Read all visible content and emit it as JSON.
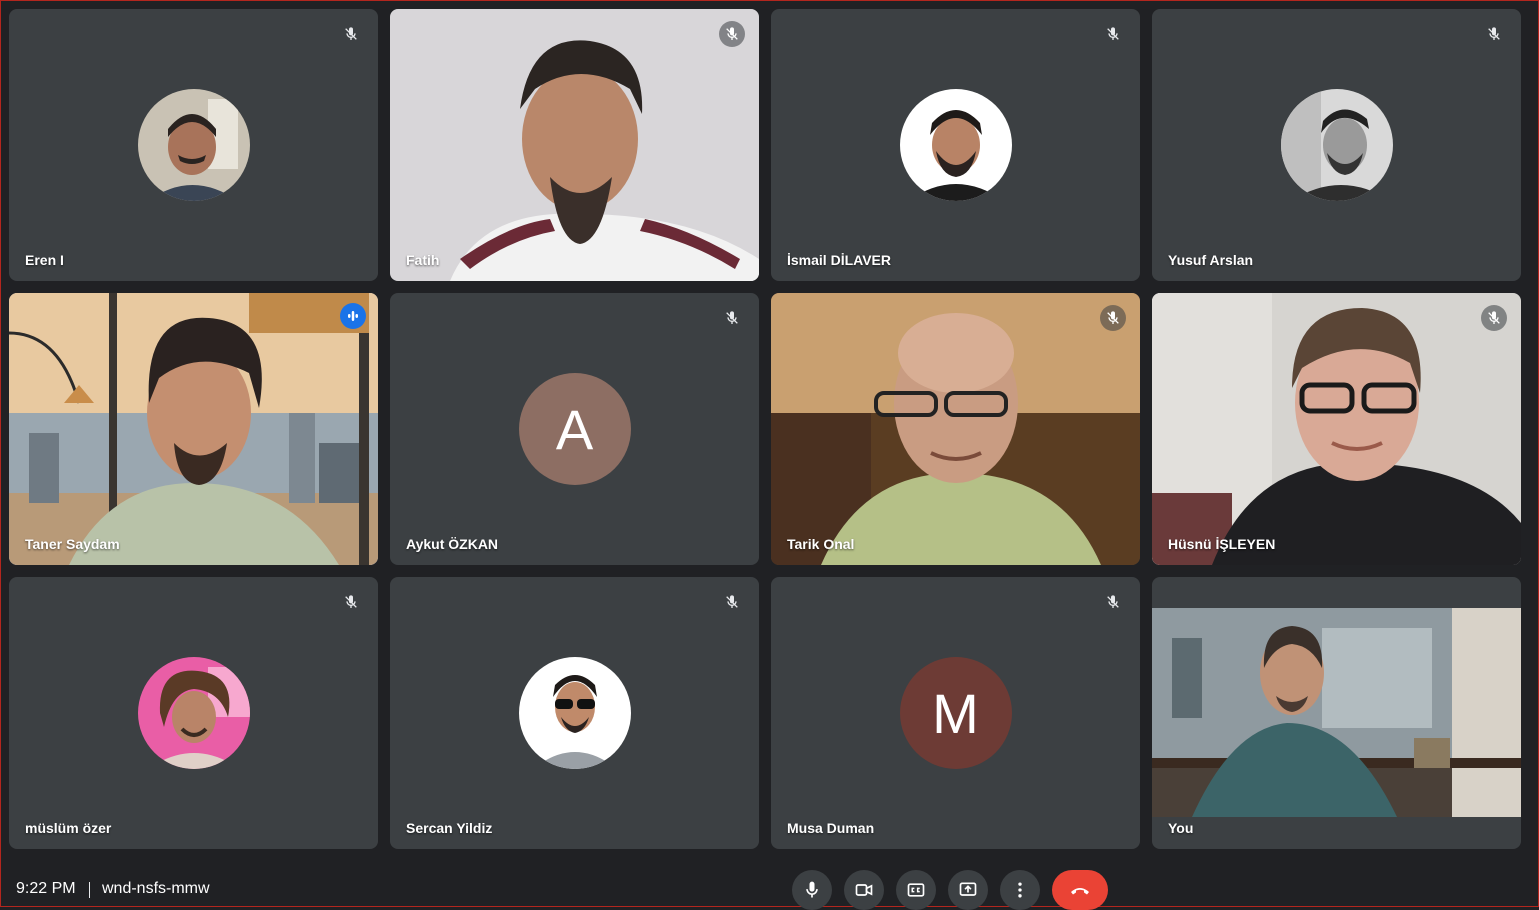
{
  "meeting": {
    "time": "9:22 PM",
    "code": "wnd-nsfs-mmw"
  },
  "participants": [
    {
      "name": "Eren I",
      "mode": "avatar-photo",
      "muted": true
    },
    {
      "name": "Fatih",
      "mode": "video",
      "muted": true
    },
    {
      "name": "İsmail DİLAVER",
      "mode": "avatar-photo",
      "muted": true
    },
    {
      "name": "Yusuf Arslan",
      "mode": "avatar-photo",
      "muted": true
    },
    {
      "name": "Taner Saydam",
      "mode": "video",
      "muted": false,
      "speaking": true
    },
    {
      "name": "Aykut ÖZKAN",
      "mode": "letter",
      "letter": "A",
      "color": "#8d6e63",
      "muted": true
    },
    {
      "name": "Tarik Onal",
      "mode": "video",
      "muted": true
    },
    {
      "name": "Hüsnü İŞLEYEN",
      "mode": "video",
      "muted": true
    },
    {
      "name": "müslüm özer",
      "mode": "avatar-photo",
      "muted": true
    },
    {
      "name": "Sercan Yildiz",
      "mode": "avatar-photo",
      "muted": true
    },
    {
      "name": "Musa Duman",
      "mode": "letter",
      "letter": "M",
      "color": "#6d3b35",
      "muted": true
    },
    {
      "name": "You",
      "mode": "video",
      "muted": false
    }
  ],
  "controls": [
    {
      "name": "microphone",
      "icon": "mic-icon"
    },
    {
      "name": "camera",
      "icon": "videocam-icon"
    },
    {
      "name": "captions",
      "icon": "closed-caption-icon"
    },
    {
      "name": "present",
      "icon": "present-screen-icon"
    },
    {
      "name": "more-options",
      "icon": "more-vert-icon"
    },
    {
      "name": "leave-call",
      "icon": "call-end-icon"
    }
  ],
  "colors": {
    "background": "#202124",
    "tile": "#3c4043",
    "active_outline": "#8ab4f8",
    "speaking": "#1a73e8",
    "end_call": "#ea4335"
  }
}
